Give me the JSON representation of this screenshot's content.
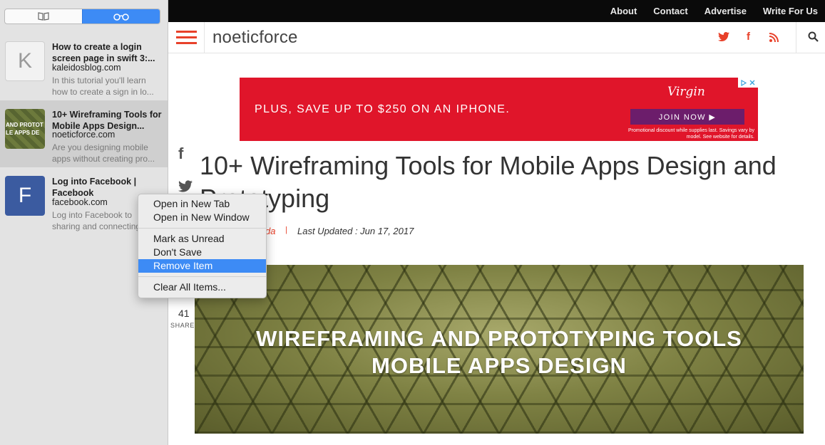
{
  "sidebar": {
    "segments": [
      "bookmarks",
      "reading-list"
    ],
    "items": [
      {
        "thumb_letter": "K",
        "title": "How to create a login screen page in swift 3:...",
        "domain": "kaleidosblog.com",
        "desc1": "In this tutorial you'll learn",
        "desc2": "how to create a sign in lo..."
      },
      {
        "thumb_line1": "AND PROTOT",
        "thumb_line2": "LE APPS DE",
        "title": "10+ Wireframing Tools for Mobile Apps Design...",
        "domain": "noeticforce.com",
        "desc1": "Are you designing mobile",
        "desc2": "apps without creating pro..."
      },
      {
        "thumb_letter": "F",
        "title": "Log into Facebook | Facebook",
        "domain": "facebook.com",
        "desc1": "Log into Facebook to",
        "desc2": "sharing and connecting..."
      }
    ]
  },
  "topnav": [
    "About",
    "Contact",
    "Advertise",
    "Write For Us"
  ],
  "header": {
    "logo": "noeticforce"
  },
  "ad": {
    "text": "PLUS, SAVE UP TO $250 ON AN IPHONE.",
    "brand": "Virgin",
    "button": "JOIN NOW ▶",
    "fine_print": "Promotional discount while supplies last. Savings vary by model. See website for details."
  },
  "article": {
    "title": "10+ Wireframing Tools for Mobile Apps Design and Prototyping",
    "author": "da",
    "separator": "|",
    "date": "Last Updated : Jun 17, 2017",
    "hero_line1": "WIREFRAMING AND PROTOTYPING TOOLS",
    "hero_line2": "MOBILE APPS DESIGN"
  },
  "share": {
    "count": "41",
    "label": "SHARES"
  },
  "context_menu": {
    "group1": [
      "Open in New Tab",
      "Open in New Window"
    ],
    "group2": [
      "Mark as Unread",
      "Don't Save",
      "Remove Item"
    ],
    "group3": [
      "Clear All Items..."
    ],
    "highlighted": "Remove Item"
  },
  "colors": {
    "accent": "#e8412a",
    "selection": "#3d8bf5",
    "ad_bg": "#e0152a"
  }
}
